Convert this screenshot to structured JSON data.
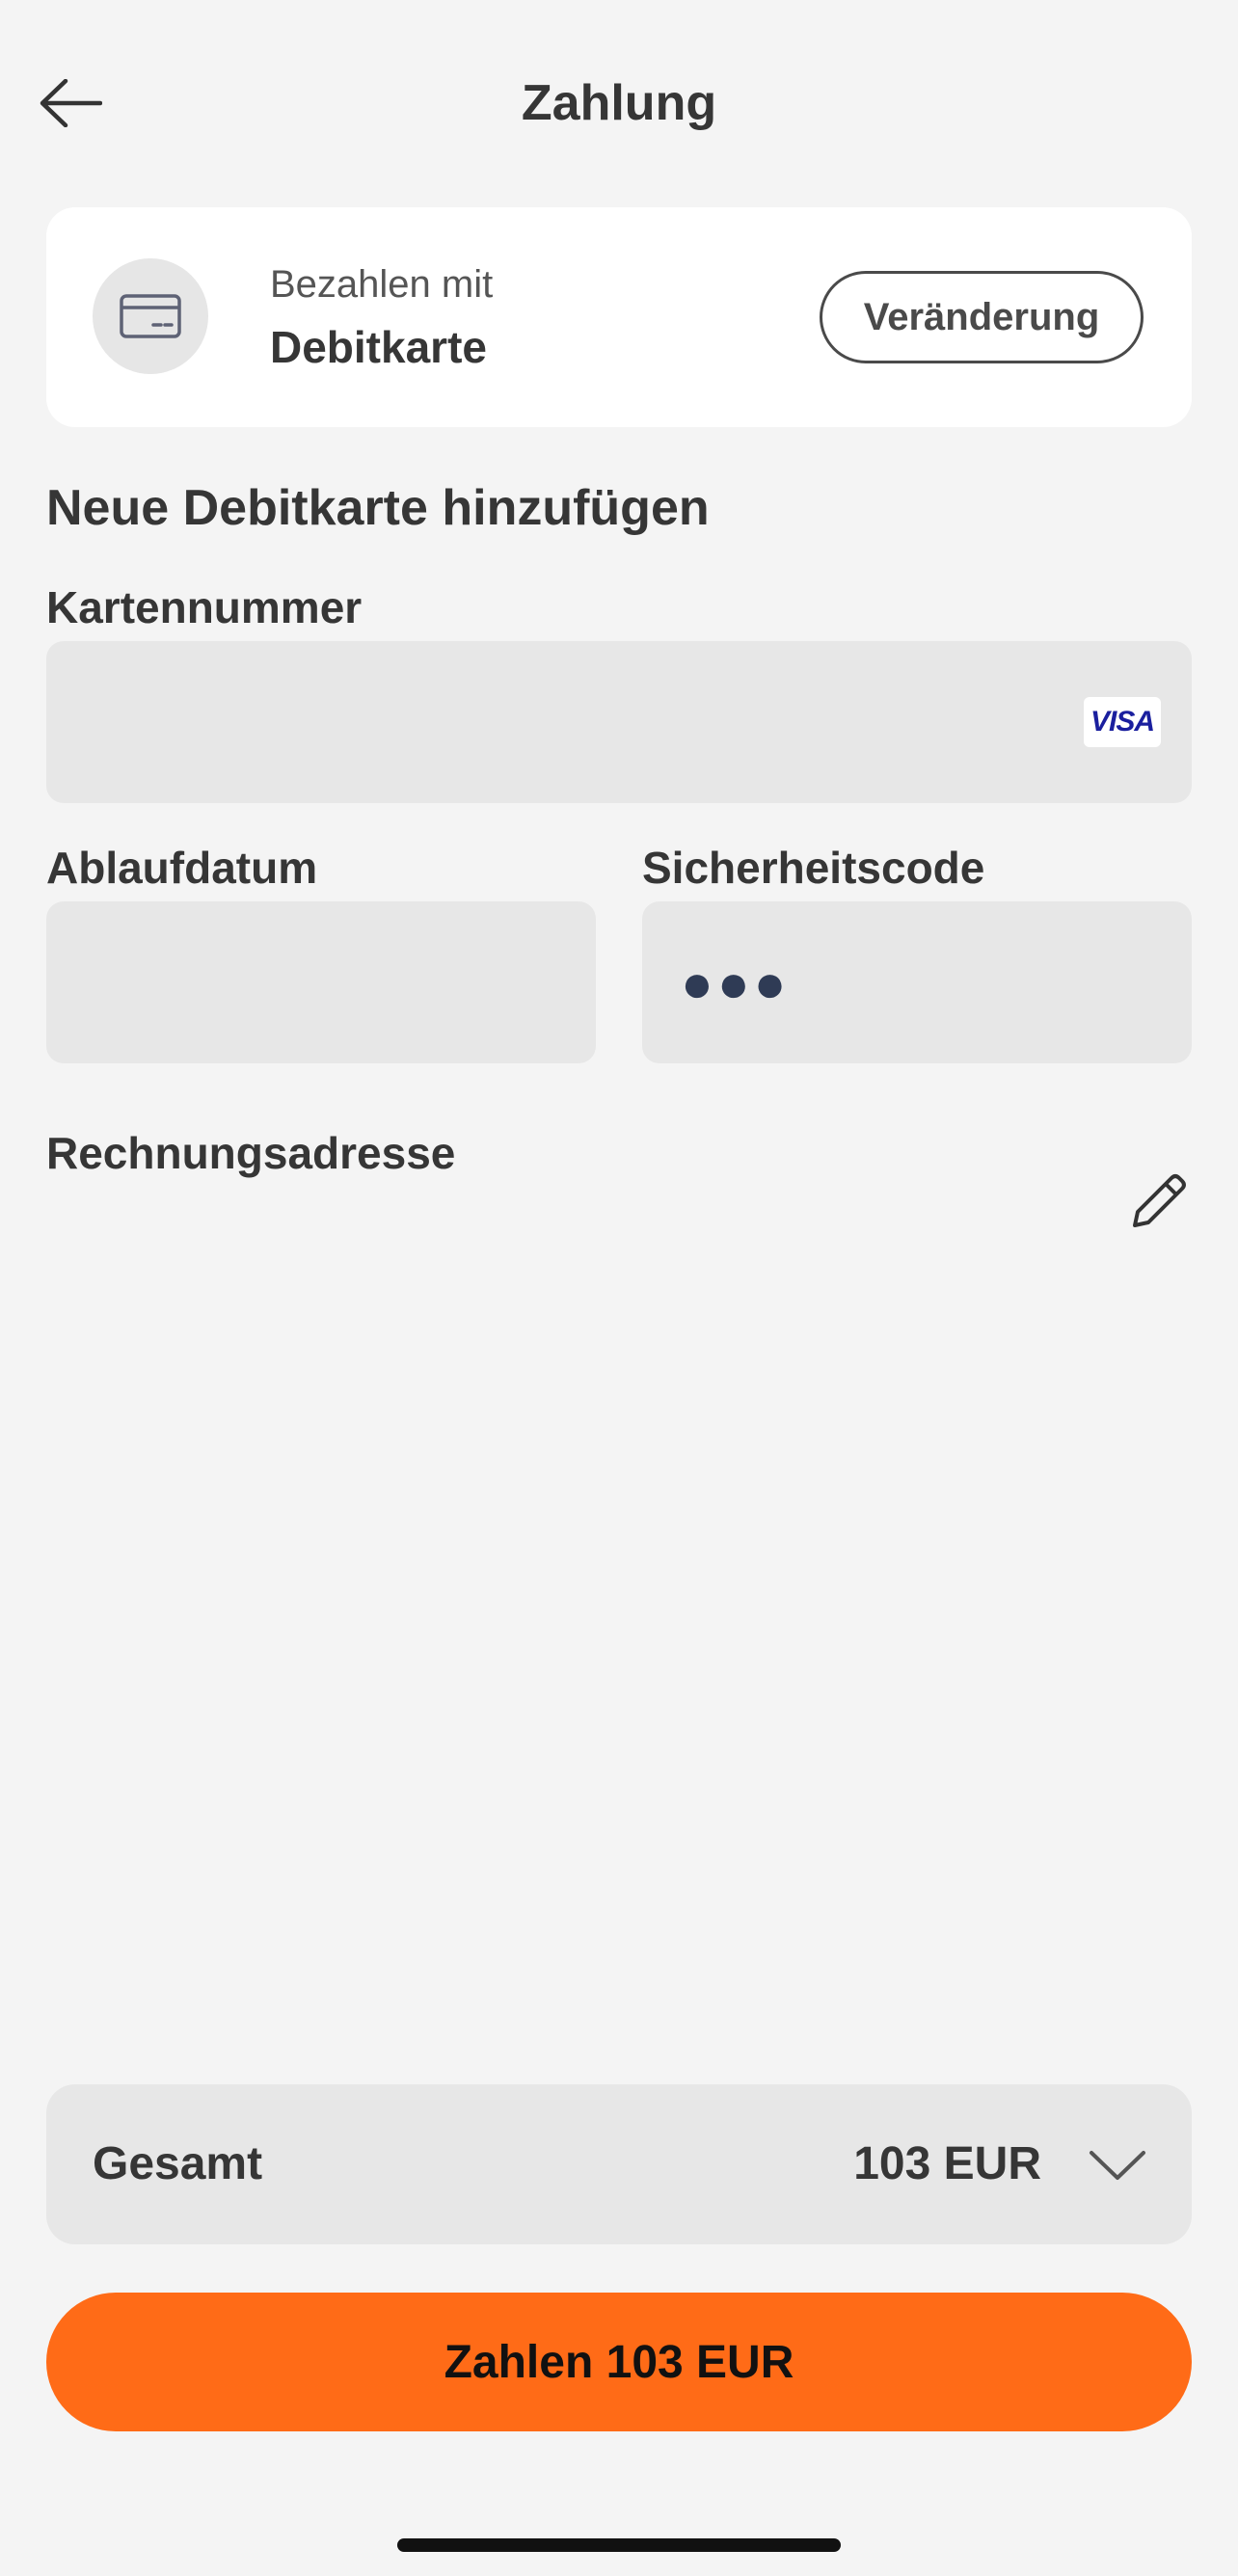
{
  "header": {
    "title": "Zahlung",
    "back_icon": "arrow-left-icon"
  },
  "payment_method": {
    "label": "Bezahlen mit",
    "value": "Debitkarte",
    "change_label": "Veränderung",
    "icon": "credit-card-icon"
  },
  "form": {
    "section_title": "Neue Debitkarte hinzufügen",
    "card_number_label": "Kartennummer",
    "card_number_value": "",
    "card_brand": "VISA",
    "expiry_label": "Ablaufdatum",
    "expiry_value": "",
    "cvc_label": "Sicherheitscode",
    "cvc_value": "●●●",
    "billing_label": "Rechnungsadresse",
    "edit_icon": "pencil-icon"
  },
  "summary": {
    "total_label": "Gesamt",
    "total_amount": "103 EUR",
    "expand_icon": "chevron-down-icon"
  },
  "pay_button": {
    "label": "Zahlen 103 EUR"
  },
  "colors": {
    "background": "#f4f4f4",
    "accent": "#ff6b17",
    "field": "#e7e7e7",
    "card": "#ffffff"
  }
}
